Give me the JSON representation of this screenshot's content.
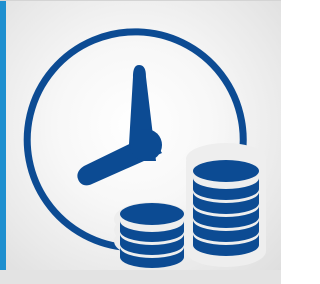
{
  "tile": {
    "icon": "time-is-money-icon",
    "accent_color": "#1e8fcf",
    "icon_color": "#0c4b93",
    "background_color": "#eeeeee"
  }
}
